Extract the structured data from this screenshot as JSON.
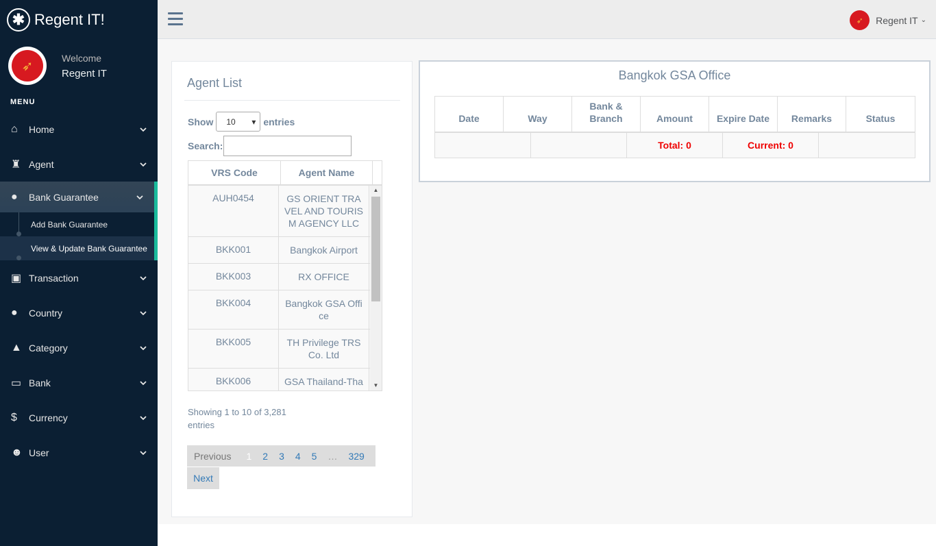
{
  "brand": {
    "title": "Regent IT!",
    "logo_icon": "asterisk-icon"
  },
  "profile": {
    "welcome": "Welcome",
    "name": "Regent IT"
  },
  "menu_heading": "MENU",
  "nav": [
    {
      "label": "Home",
      "icon": "home-icon"
    },
    {
      "label": "Agent",
      "icon": "agent-icon"
    },
    {
      "label": "Bank Guarantee",
      "icon": "globe-icon"
    },
    {
      "label": "Transaction",
      "icon": "money-icon"
    },
    {
      "label": "Country",
      "icon": "globe-icon"
    },
    {
      "label": "Category",
      "icon": "tree-icon"
    },
    {
      "label": "Bank",
      "icon": "credit-card-icon"
    },
    {
      "label": "Currency",
      "icon": "dollar-icon"
    },
    {
      "label": "User",
      "icon": "user-icon"
    }
  ],
  "subnav": [
    {
      "label": "Add Bank Guarantee"
    },
    {
      "label": "View & Update Bank Guarantee"
    }
  ],
  "topbar": {
    "user_name": "Regent IT"
  },
  "agent_list": {
    "title": "Agent List",
    "show_label": "Show",
    "entries_select": "10",
    "entries_label": "entries",
    "search_label": "Search:",
    "search_value": "",
    "columns": [
      "VRS Code",
      "Agent Name"
    ],
    "rows": [
      {
        "code": "AUH0454",
        "name": "GS ORIENT TRAVEL AND TOURISM AGENCY LLC"
      },
      {
        "code": "BKK001",
        "name": "Bangkok Airport"
      },
      {
        "code": "BKK003",
        "name": "RX OFFICE"
      },
      {
        "code": "BKK004",
        "name": "Bangkok GSA Office"
      },
      {
        "code": "BKK005",
        "name": "TH Privilege TRS Co. Ltd"
      },
      {
        "code": "BKK006",
        "name": "GSA Thailand-Thai Star Air Co. Ltd"
      }
    ],
    "info": "Showing 1 to 10 of 3,281 entries",
    "pager": {
      "previous": "Previous",
      "pages": [
        "1",
        "2",
        "3",
        "4",
        "5"
      ],
      "ellipsis": "…",
      "last": "329",
      "next": "Next"
    }
  },
  "guarantee": {
    "office": "Bangkok GSA Office",
    "columns": [
      "Date",
      "Way",
      "Bank & Branch",
      "Amount",
      "Expire Date",
      "Remarks",
      "Status"
    ],
    "total": "Total: 0",
    "current": "Current: 0"
  },
  "colors": {
    "sidebar": "#0B1F33",
    "accent": "#1ABB9C",
    "danger": "#EE0000",
    "link": "#337AB7"
  }
}
